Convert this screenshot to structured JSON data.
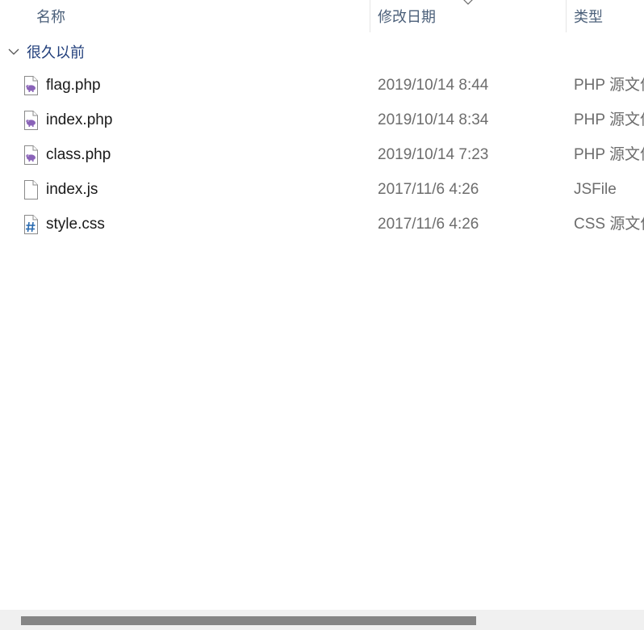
{
  "columns": {
    "name": "名称",
    "date": "修改日期",
    "type": "类型"
  },
  "sort": {
    "column": "date",
    "direction": "descending",
    "icon": "chevron-down-icon"
  },
  "group": {
    "label": "很久以前",
    "expanded": true
  },
  "files": [
    {
      "name": "flag.php",
      "date": "2019/10/14 8:44",
      "type": "PHP 源文件",
      "icon": "php-file-icon"
    },
    {
      "name": "index.php",
      "date": "2019/10/14 8:34",
      "type": "PHP 源文件",
      "icon": "php-file-icon"
    },
    {
      "name": "class.php",
      "date": "2019/10/14 7:23",
      "type": "PHP 源文件",
      "icon": "php-file-icon"
    },
    {
      "name": "index.js",
      "date": "2017/11/6 4:26",
      "type": "JSFile",
      "icon": "blank-file-icon"
    },
    {
      "name": "style.css",
      "date": "2017/11/6 4:26",
      "type": "CSS 源文件",
      "icon": "css-file-icon"
    }
  ],
  "colors": {
    "header_text": "#4c607a",
    "group_text": "#1f3d7a",
    "name_text": "#1a1a1a",
    "secondary_text": "#6d6d6d",
    "php_icon": "#8a63b8",
    "css_icon": "#2a6bb0",
    "scrollbar_thumb": "#858585"
  }
}
